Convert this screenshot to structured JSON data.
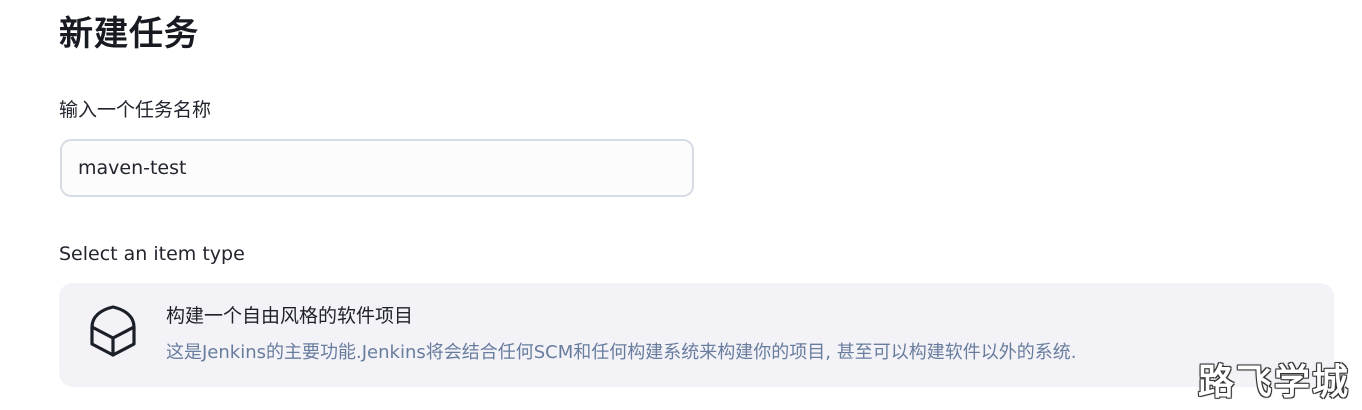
{
  "page": {
    "title": "新建任务"
  },
  "item_name": {
    "label": "输入一个任务名称",
    "value": "maven-test"
  },
  "item_type": {
    "label": "Select an item type",
    "options": [
      {
        "title": "构建一个自由风格的软件项目",
        "description": "这是Jenkins的主要功能.Jenkins将会结合任何SCM和任何构建系统来构建你的项目, 甚至可以构建软件以外的系统.",
        "icon": "package-icon"
      }
    ]
  },
  "watermark": {
    "text": "路飞学城"
  },
  "colors": {
    "card_background": "#f3f2f7",
    "description_text": "#687d9e",
    "input_border": "#d6dbe4"
  }
}
